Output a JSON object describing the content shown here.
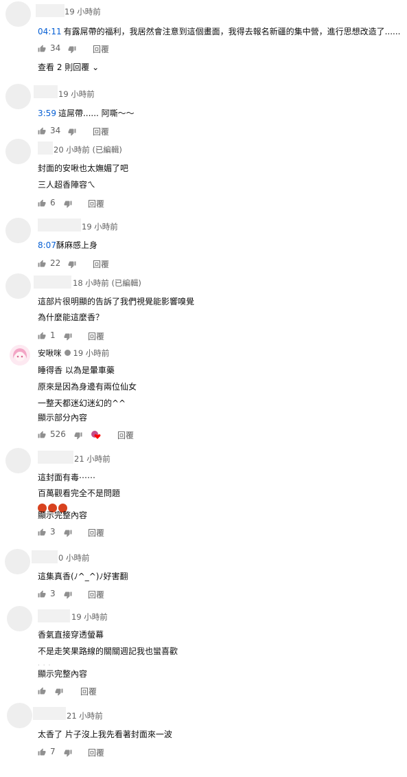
{
  "comments": [
    {
      "time": "19 小時前",
      "lines": [
        {
          "ts": "04:11",
          "text": "有露屌帶的福利，我居然會注意到這個畫面，我得去報名新疆的集中營，進行思想改造了......"
        }
      ],
      "likes": "34",
      "reply": "回覆",
      "replies_link": "查看 2 則回覆"
    },
    {
      "time": "19 小時前",
      "lines": [
        {
          "ts": "3:59",
          "text": "這屌帶...... 阿嘶〜〜"
        }
      ],
      "likes": "34",
      "reply": "回覆"
    },
    {
      "time": "20 小時前 (已編輯)",
      "lines": [
        {
          "text": "封面的安啾也太嫵媚了吧"
        },
        {
          "text": "三人超香陣容ㄟ"
        }
      ],
      "likes": "6",
      "reply": "回覆"
    },
    {
      "time": "19 小時前",
      "lines": [
        {
          "ts": "8:07",
          "text": "酥麻感上身"
        }
      ],
      "likes": "22",
      "reply": "回覆"
    },
    {
      "time": "18 小時前 (已編輯)",
      "lines": [
        {
          "text": "這部片很明顯的告訴了我們視覺能影響嗅覺"
        },
        {
          "text": "為什麼能這麼香？"
        }
      ],
      "likes": "1",
      "reply": "回覆"
    },
    {
      "author": "安啾咪",
      "time": "19 小時前",
      "lines": [
        {
          "text": "睡得香 以為是暈車藥"
        },
        {
          "text": "原來是因為身邊有兩位仙女"
        },
        {
          "text": "一整天都迷幻迷幻的^^"
        }
      ],
      "more": "顯示部分內容",
      "likes": "526",
      "reply": "回覆"
    },
    {
      "time": "21 小時前",
      "lines": [
        {
          "text": "這封面有毒⋯⋯"
        },
        {
          "text": "百萬觀看完全不是問題"
        }
      ],
      "more": "顯示完整內容",
      "likes": "3",
      "reply": "回覆"
    },
    {
      "time": "0 小時前",
      "lines": [
        {
          "text": "這集真香(ﾉ^_^)ﾉ好害翻"
        }
      ],
      "likes": "3",
      "reply": "回覆"
    },
    {
      "time": "19 小時前",
      "lines": [
        {
          "text": "香氣直接穿透螢幕"
        },
        {
          "text": "不是走笑果路線的關關週記我也蠻喜歡"
        }
      ],
      "more": "顯示完整內容",
      "likes": "",
      "reply": "回覆"
    },
    {
      "time": "21 小時前",
      "lines": [
        {
          "text": "太香了 片子沒上我先看著封面來一波"
        }
      ],
      "likes": "7",
      "reply": "回覆"
    }
  ],
  "colors": {
    "link": "#065fd4",
    "muted": "#606060",
    "text": "#0f0f0f",
    "emoji": "#d8421f"
  }
}
